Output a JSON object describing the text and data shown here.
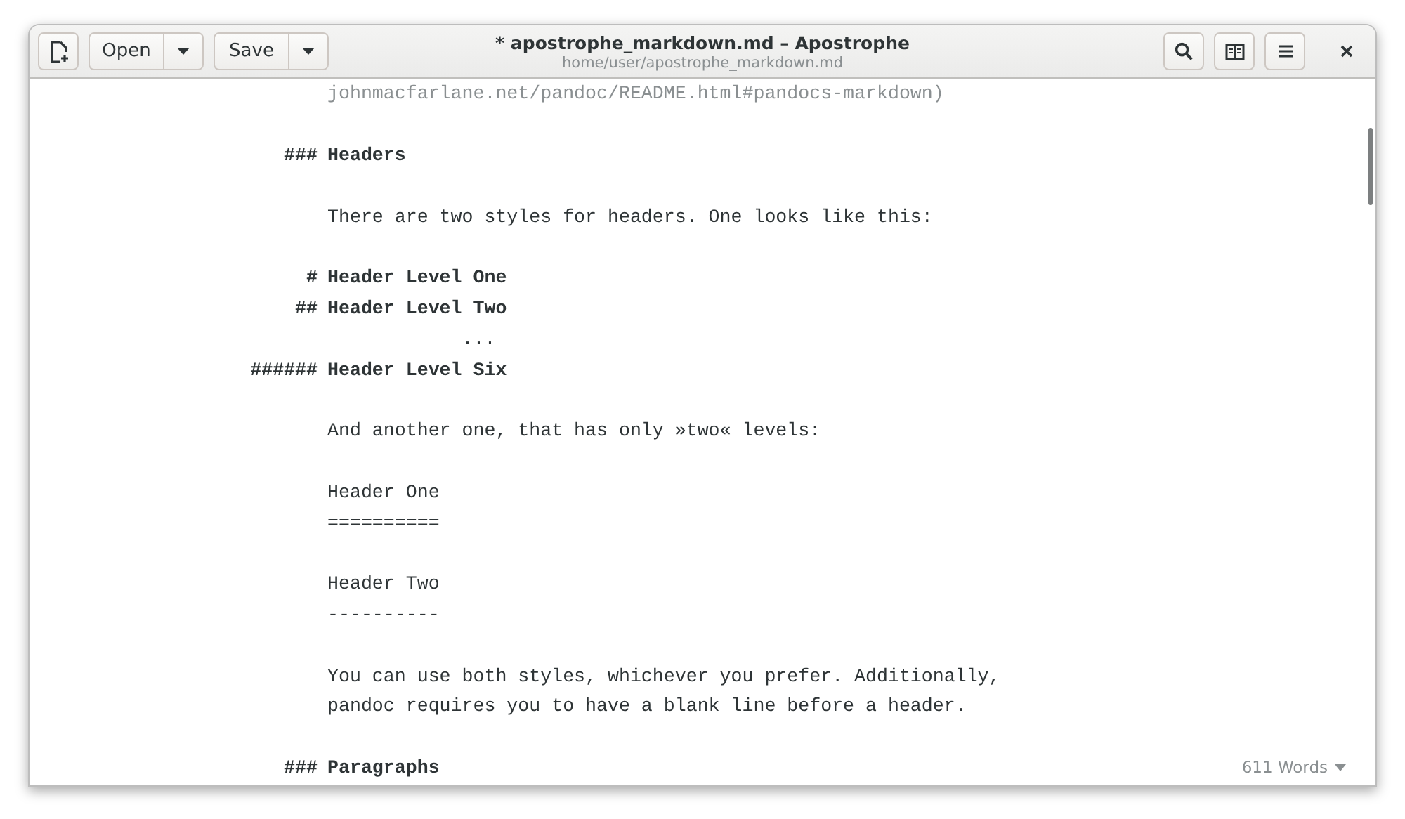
{
  "window": {
    "title": "* apostrophe_markdown.md – Apostrophe",
    "subtitle": "home/user/apostrophe_markdown.md"
  },
  "header_buttons": [
    {
      "label": "Open"
    },
    {
      "label": "Save"
    }
  ],
  "lines": [
    {
      "kind": "link",
      "text": "johnmacfarlane.net/pandoc/README.html#pandocs-markdown)"
    },
    {
      "kind": "blank"
    },
    {
      "kind": "heading",
      "marker": "###",
      "text": "Headers"
    },
    {
      "kind": "blank"
    },
    {
      "kind": "text",
      "text": "There are two styles for headers. One looks like this:"
    },
    {
      "kind": "blank"
    },
    {
      "kind": "heading",
      "marker": "#",
      "text": "Header Level One"
    },
    {
      "kind": "heading",
      "marker": "##",
      "text": "Header Level Two"
    },
    {
      "kind": "text",
      "text": "            ..."
    },
    {
      "kind": "heading",
      "marker": "######",
      "text": "Header Level Six"
    },
    {
      "kind": "blank"
    },
    {
      "kind": "text",
      "text": "And another one, that has only »two« levels:"
    },
    {
      "kind": "blank"
    },
    {
      "kind": "text",
      "text": "Header One"
    },
    {
      "kind": "text",
      "text": "=========="
    },
    {
      "kind": "blank"
    },
    {
      "kind": "text",
      "text": "Header Two"
    },
    {
      "kind": "text",
      "text": "----------"
    },
    {
      "kind": "blank"
    },
    {
      "kind": "text",
      "text": "You can use both styles, whichever you prefer. Additionally,"
    },
    {
      "kind": "text",
      "text": "pandoc requires you to have a blank line before a header."
    },
    {
      "kind": "blank"
    },
    {
      "kind": "heading",
      "marker": "###",
      "text": "Paragraphs"
    }
  ],
  "status": {
    "word_count": "611 Words"
  }
}
